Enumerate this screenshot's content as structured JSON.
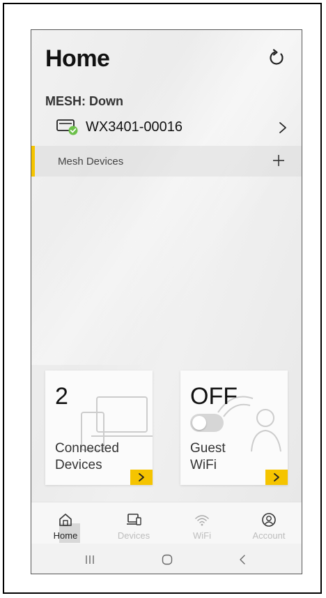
{
  "header": {
    "title": "Home",
    "refresh_icon": "refresh-icon"
  },
  "mesh": {
    "status": "MESH: Down",
    "router_name": "WX3401-00016",
    "devices_label": "Mesh Devices"
  },
  "cards": {
    "connected": {
      "count": "2",
      "label_line1": "Connected",
      "label_line2": "Devices"
    },
    "guest": {
      "state": "OFF",
      "label_line1": "Guest",
      "label_line2": "WiFi",
      "toggle_on": false
    }
  },
  "tabs": [
    {
      "label": "Home",
      "icon": "home-icon",
      "active": true
    },
    {
      "label": "Devices",
      "icon": "devices-icon",
      "active": false
    },
    {
      "label": "WiFi",
      "icon": "wifi-icon",
      "active": false
    },
    {
      "label": "Account",
      "icon": "account-icon",
      "active": false
    }
  ],
  "system_nav": {
    "recents_icon": "recents-icon",
    "home_icon": "system-home-icon",
    "back_icon": "back-icon"
  },
  "colors": {
    "accent": "#f5c400",
    "status_ok": "#6cc04a"
  }
}
